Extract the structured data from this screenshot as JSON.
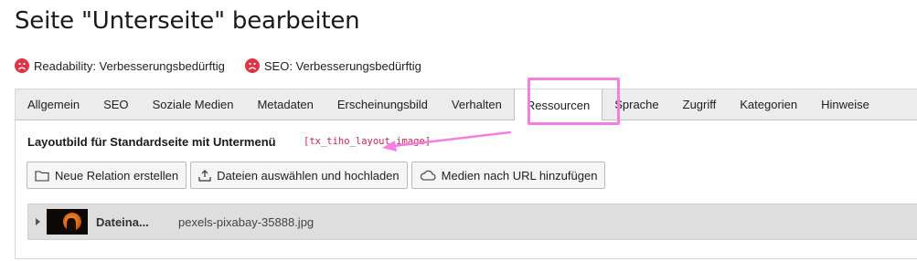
{
  "page": {
    "title": "Seite \"Unterseite\" bearbeiten"
  },
  "status": [
    {
      "label": "Readability: Verbesserungsbedürftig",
      "icon": "sad-face-icon",
      "color": "#dc3545"
    },
    {
      "label": "SEO: Verbesserungsbedürftig",
      "icon": "sad-face-icon",
      "color": "#dc3545"
    }
  ],
  "tabs": [
    {
      "label": "Allgemein"
    },
    {
      "label": "SEO"
    },
    {
      "label": "Soziale Medien"
    },
    {
      "label": "Metadaten"
    },
    {
      "label": "Erscheinungsbild"
    },
    {
      "label": "Verhalten"
    },
    {
      "label": "Ressourcen",
      "active": true
    },
    {
      "label": "Sprache"
    },
    {
      "label": "Zugriff"
    },
    {
      "label": "Kategorien"
    },
    {
      "label": "Hinweise"
    }
  ],
  "field": {
    "label": "Layoutbild für Standardseite mit Untermenü",
    "code": "[tx_tiho_layout_image]"
  },
  "buttons": {
    "new_relation": "Neue Relation erstellen",
    "upload": "Dateien auswählen und hochladen",
    "media_url": "Medien nach URL hinzufügen"
  },
  "file": {
    "label": "Dateina...",
    "name": "pexels-pixabay-35888.jpg"
  },
  "colors": {
    "highlight": "#f57ee0",
    "status_bad": "#dc3545",
    "code": "#c7254e"
  }
}
